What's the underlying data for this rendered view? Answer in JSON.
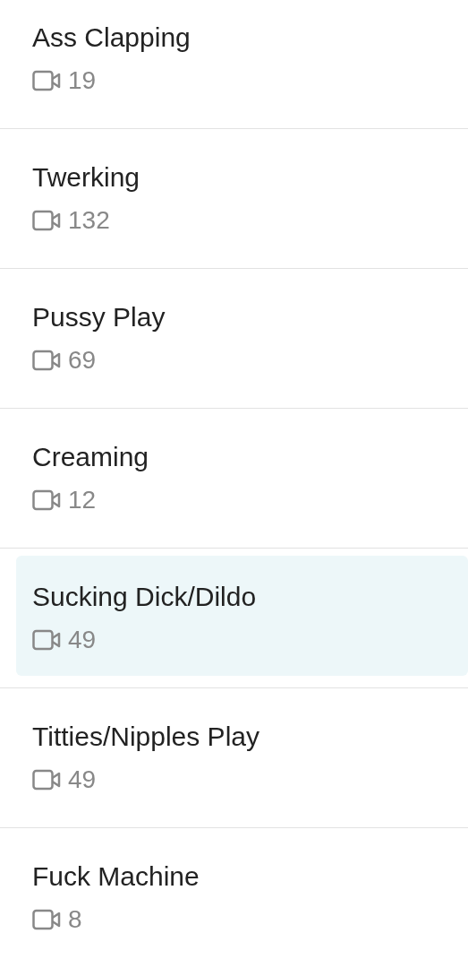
{
  "categories": [
    {
      "title": "Ass Clapping",
      "count": "19",
      "selected": false
    },
    {
      "title": "Twerking",
      "count": "132",
      "selected": false
    },
    {
      "title": "Pussy Play",
      "count": "69",
      "selected": false
    },
    {
      "title": "Creaming",
      "count": "12",
      "selected": false
    },
    {
      "title": "Sucking Dick/Dildo",
      "count": "49",
      "selected": true
    },
    {
      "title": "Titties/Nipples Play",
      "count": "49",
      "selected": false
    },
    {
      "title": "Fuck Machine",
      "count": "8",
      "selected": false
    }
  ]
}
